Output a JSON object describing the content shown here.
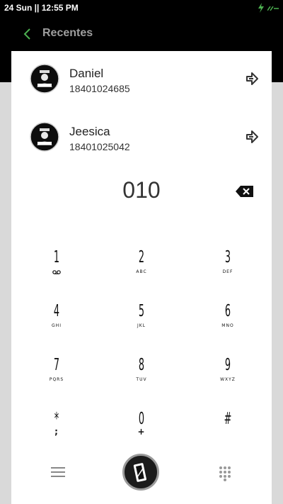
{
  "status_bar": {
    "time": "24 Sun || 12:55 PM"
  },
  "app_bar": {
    "title": "Recentes"
  },
  "contacts": [
    {
      "name": "Daniel",
      "number": "18401024685"
    },
    {
      "name": "Jeesica",
      "number": "18401025042"
    }
  ],
  "dialer": {
    "dialed_number": "010"
  },
  "keypad": [
    {
      "digit": "1",
      "sub": ""
    },
    {
      "digit": "2",
      "sub": "ABC"
    },
    {
      "digit": "3",
      "sub": "DEF"
    },
    {
      "digit": "4",
      "sub": "GHI"
    },
    {
      "digit": "5",
      "sub": "JKL"
    },
    {
      "digit": "6",
      "sub": "MNO"
    },
    {
      "digit": "7",
      "sub": "PQRS"
    },
    {
      "digit": "8",
      "sub": "TUV"
    },
    {
      "digit": "9",
      "sub": "WXYZ"
    },
    {
      "digit": "*",
      "sub": ";"
    },
    {
      "digit": "0",
      "sub": "+"
    },
    {
      "digit": "#",
      "sub": ""
    }
  ],
  "colors": {
    "accent": "#4caf50",
    "background": "#000000",
    "card": "#ffffff",
    "call_button": "#1b1b1b"
  },
  "icons": {
    "back": "chevron-left-icon",
    "call_arrow": "call-arrow-icon",
    "backspace": "backspace-icon",
    "voicemail": "voicemail-icon",
    "menu": "menu-icon",
    "call": "phone-call-icon",
    "dialpad": "dialpad-icon"
  }
}
